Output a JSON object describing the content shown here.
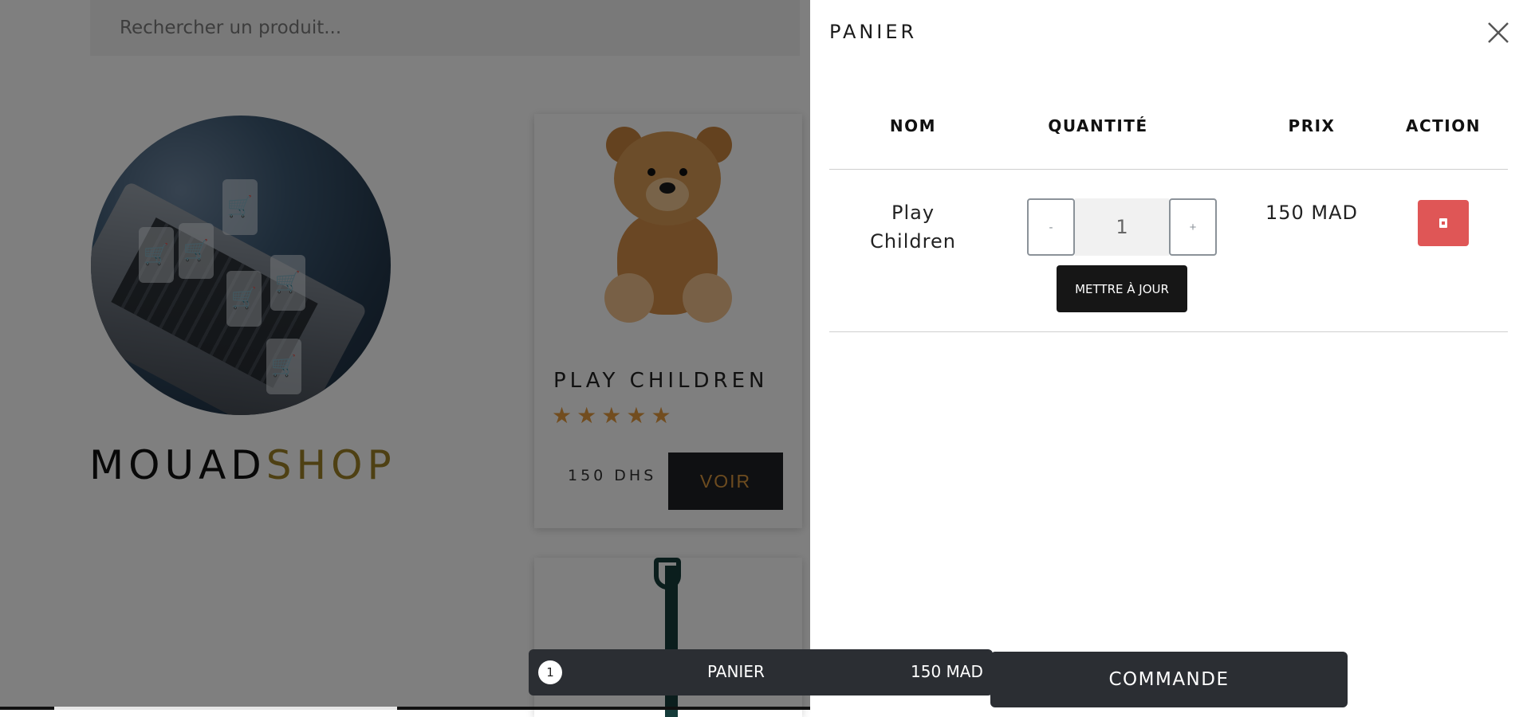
{
  "search": {
    "placeholder": "Rechercher un produit..."
  },
  "brand": {
    "part1": "MOUAD",
    "part2": "SHOP"
  },
  "product": {
    "name": "PLAY CHILDREN",
    "rating": 5,
    "stars": [
      "★",
      "★",
      "★",
      "★",
      "★"
    ],
    "price": "150 DHS",
    "button_label": "VOIR"
  },
  "cart_drawer": {
    "title": "PANIER",
    "columns": {
      "name": "NOM",
      "quantity": "QUANTITÉ",
      "price": "PRIX",
      "action": "ACTION"
    },
    "items": [
      {
        "name": "Play Children",
        "qty_minus": "-",
        "quantity": "1",
        "qty_plus": "+",
        "update_label": "METTRE À JOUR",
        "price": "150 MAD"
      }
    ]
  },
  "cart_bar": {
    "count": "1",
    "label": "PANIER",
    "total": "150 MAD"
  },
  "order_button": {
    "label": "COMMANDE"
  },
  "colors": {
    "accent_gold": "#9c8126",
    "star": "#e59a3e",
    "delete": "#df5656",
    "dark": "#2b2e33"
  },
  "icons": {
    "close": "close-icon",
    "delete": "trash-icon",
    "star": "star-icon"
  }
}
